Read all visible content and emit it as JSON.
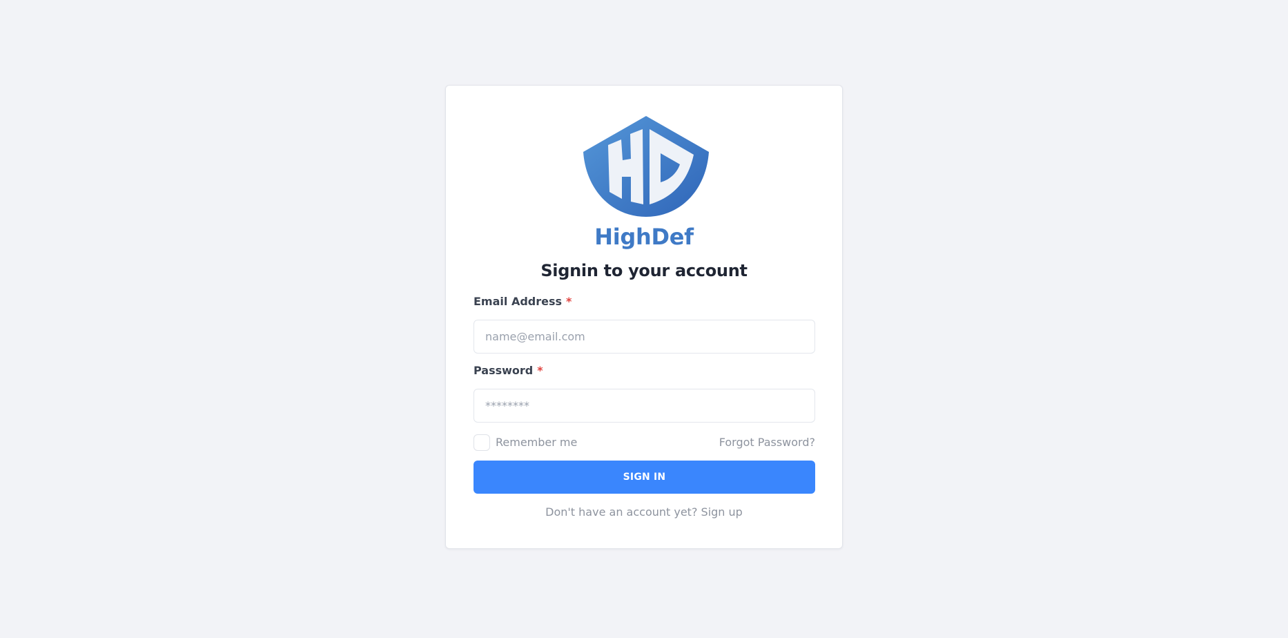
{
  "brand": {
    "name": "HighDef",
    "logo_icon": "hd-shield-logo",
    "color": "#3f7ac6"
  },
  "form": {
    "heading": "Signin to your account",
    "email": {
      "label": "Email Address",
      "required_mark": "*",
      "placeholder": "name@email.com",
      "value": ""
    },
    "password": {
      "label": "Password",
      "required_mark": "*",
      "placeholder": "********",
      "value": ""
    },
    "remember_me": {
      "label": "Remember me",
      "checked": false
    },
    "forgot_password_label": "Forgot Password?",
    "submit_label": "SIGN IN",
    "signup_prompt": "Don't have an account yet?",
    "signup_link": "Sign up"
  },
  "colors": {
    "background": "#f2f3f7",
    "primary_button": "#3a86fd",
    "required": "#e0433f"
  }
}
